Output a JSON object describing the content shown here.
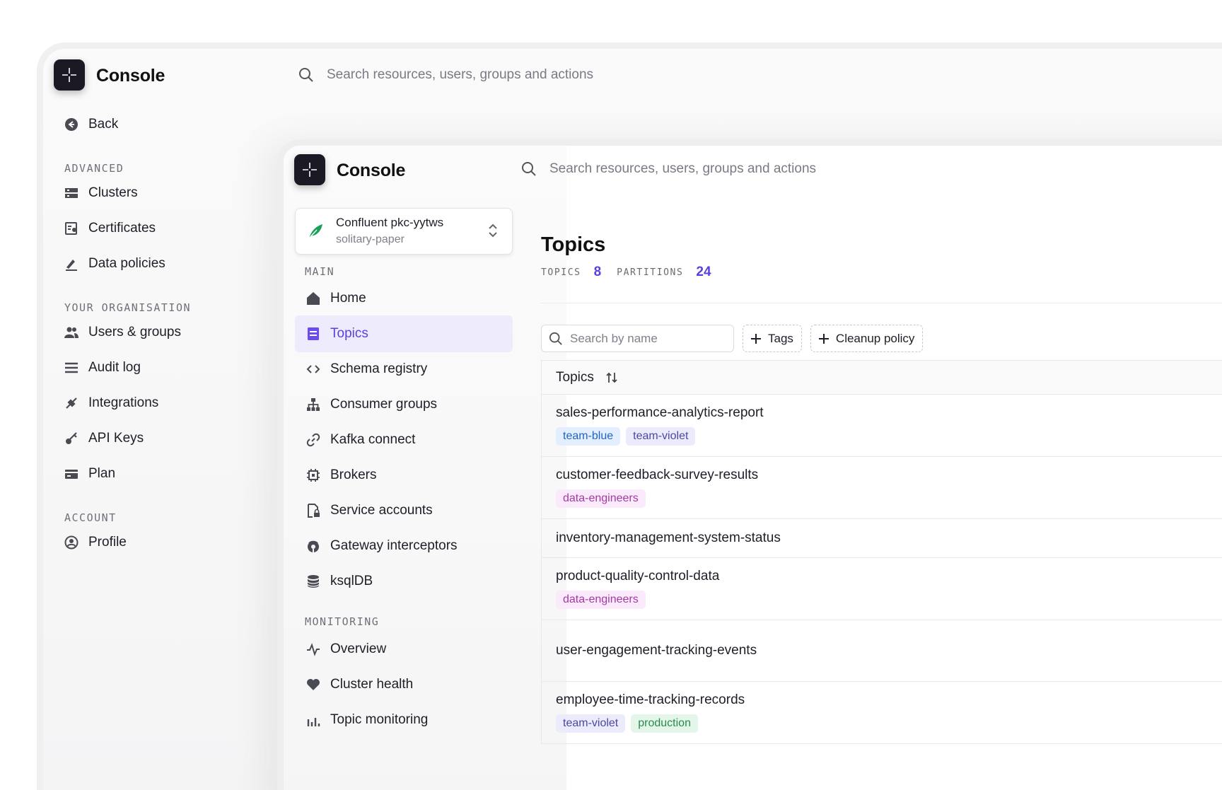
{
  "app": {
    "brand": "Console"
  },
  "search": {
    "placeholder": "Search resources, users, groups and actions"
  },
  "outer_sidebar": {
    "back": "Back",
    "sections": [
      {
        "label": "ADVANCED",
        "items": [
          "Clusters",
          "Certificates",
          "Data policies"
        ]
      },
      {
        "label": "YOUR ORGANISATION",
        "items": [
          "Users & groups",
          "Audit log",
          "Integrations",
          "API Keys",
          "Plan"
        ]
      },
      {
        "label": "ACCOUNT",
        "items": [
          "Profile"
        ]
      }
    ]
  },
  "cluster": {
    "name": "Confluent pkc-yytws",
    "sub": "solitary-paper"
  },
  "inner_sidebar": {
    "main_label": "MAIN",
    "main_items": [
      "Home",
      "Topics",
      "Schema registry",
      "Consumer groups",
      "Kafka connect",
      "Brokers",
      "Service accounts",
      "Gateway interceptors",
      "ksqlDB"
    ],
    "monitoring_label": "MONITORING",
    "monitoring_items": [
      "Overview",
      "Cluster health",
      "Topic monitoring"
    ]
  },
  "page": {
    "title": "Topics",
    "stats": [
      {
        "label": "TOPICS",
        "value": "8"
      },
      {
        "label": "PARTITIONS",
        "value": "24"
      }
    ],
    "name_search_placeholder": "Search by name",
    "filters": [
      "Tags",
      "Cleanup policy"
    ],
    "table_header": "Topics",
    "rows": [
      {
        "name": "sales-performance-analytics-report",
        "tags": [
          "team-blue",
          "team-violet"
        ]
      },
      {
        "name": "customer-feedback-survey-results",
        "tags": [
          "data-engineers"
        ]
      },
      {
        "name": "inventory-management-system-status",
        "tags": []
      },
      {
        "name": "product-quality-control-data",
        "tags": [
          "data-engineers"
        ]
      },
      {
        "name": "user-engagement-tracking-events",
        "tags": []
      },
      {
        "name": "employee-time-tracking-records",
        "tags": [
          "team-violet",
          "production"
        ]
      }
    ]
  },
  "colors": {
    "accent": "#5b3fe0",
    "active_bg": "#eeebfd",
    "brand_dark": "#1b1a24"
  }
}
